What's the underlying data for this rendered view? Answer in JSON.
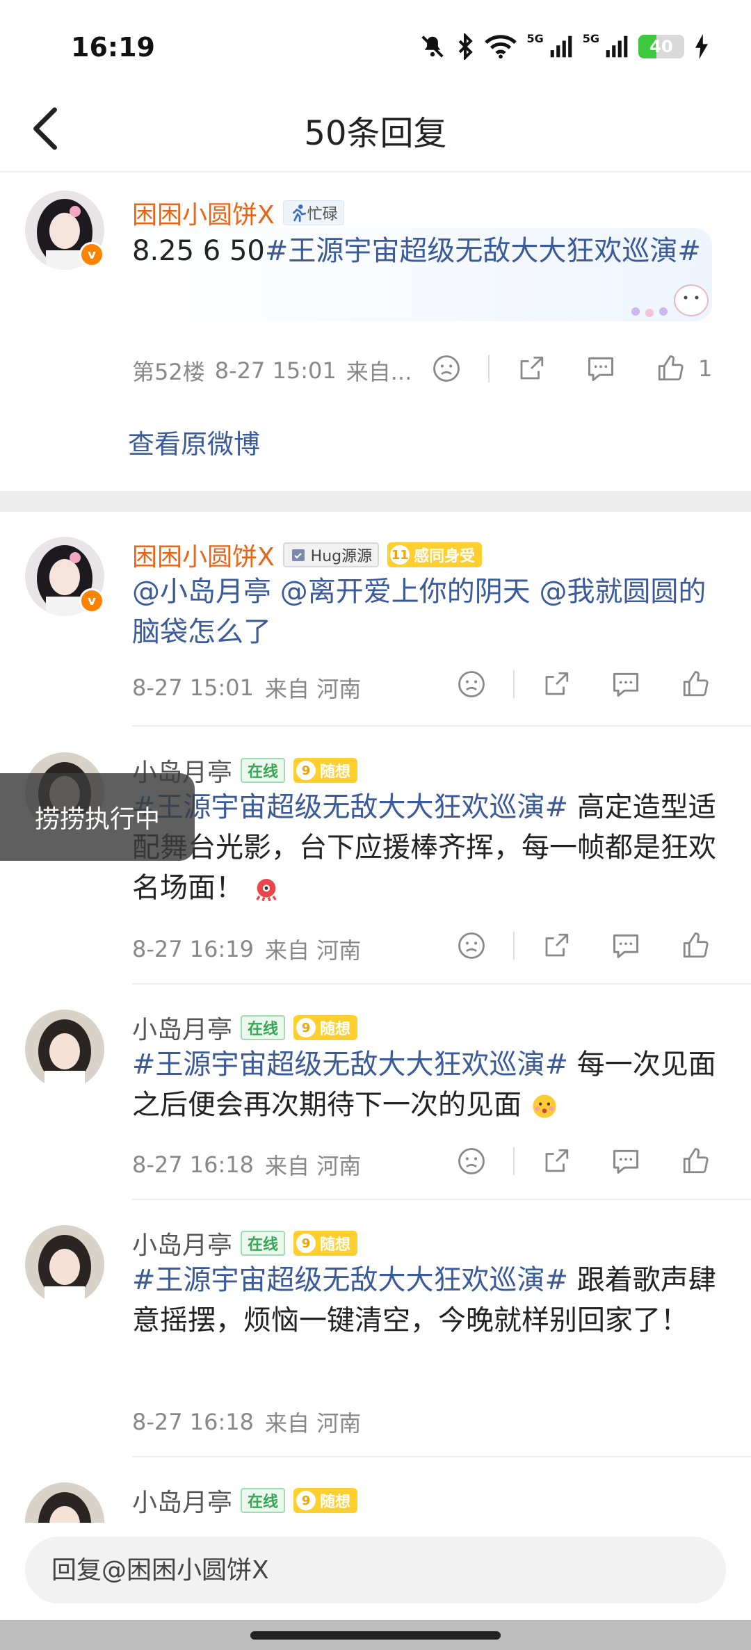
{
  "status_bar": {
    "time": "16:19",
    "net1": "5G",
    "net2": "5G",
    "battery_level": "40",
    "battery_fill_percent": 40
  },
  "nav": {
    "title": "50条回复"
  },
  "main_post": {
    "user_name": "困困小圆饼X",
    "status_tag": "忙碌",
    "text_prefix": "8.25 6 50",
    "topic": "#王源宇宙超级无敌大大狂欢巡演#",
    "floor": "第52楼",
    "time": "8-27 15:01",
    "source": "来自...",
    "like_count": "1",
    "view_original": "查看原微博"
  },
  "replies": [
    {
      "user_name": "困困小圆饼X",
      "badge1": "Hug源源",
      "badge2_level": "11",
      "badge2": "感同身受",
      "mentions": [
        "@小岛月亭",
        "@离开爱上你的阴天",
        "@我就圆圆的脑袋怎么了"
      ],
      "time": "8-27 15:01",
      "source": "来自 河南"
    },
    {
      "user_name": "小岛月亭",
      "online": "在线",
      "level": "9",
      "level_text": "随想",
      "topic": "#王源宇宙超级无敌大大狂欢巡演#",
      "text": " 高定造型适配舞台光影，台下应援棒齐挥，每一帧都是狂欢名场面！",
      "time": "8-27 16:19",
      "source": "来自 河南"
    },
    {
      "user_name": "小岛月亭",
      "online": "在线",
      "level": "9",
      "level_text": "随想",
      "topic": "#王源宇宙超级无敌大大狂欢巡演#",
      "text": " 每一次见面之后便会再次期待下一次的见面",
      "time": "8-27 16:18",
      "source": "来自 河南"
    },
    {
      "user_name": "小岛月亭",
      "online": "在线",
      "level": "9",
      "level_text": "随想",
      "topic": "#王源宇宙超级无敌大大狂欢巡演#",
      "text": " 跟着歌声肆意摇摆，烦恼一键清空，今晚就样别回家了！",
      "time": "8-27 16:18",
      "source": "来自 河南"
    },
    {
      "user_name": "小岛月亭",
      "online": "在线",
      "level": "9",
      "level_text": "随想"
    }
  ],
  "toast": "捞捞执行中",
  "reply_bar": {
    "placeholder": "回复@困困小圆饼X"
  }
}
